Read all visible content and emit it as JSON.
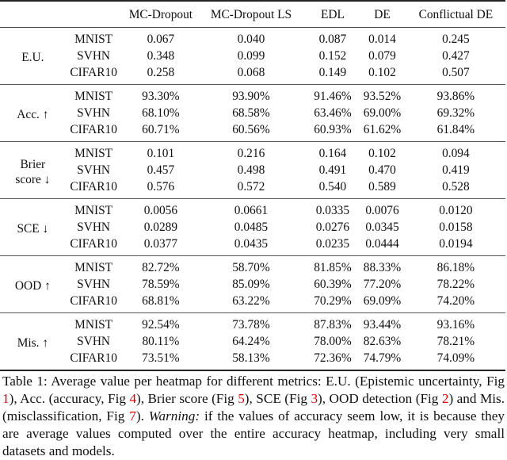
{
  "table": {
    "columns": [
      "",
      "",
      "MC-Dropout",
      "MC-Dropout LS",
      "EDL",
      "DE",
      "Conflictual DE"
    ],
    "groups": [
      {
        "metric": "E.U.",
        "rows": [
          {
            "dataset": "MNIST",
            "values": [
              "0.067",
              "0.040",
              "0.087",
              "0.014",
              "0.245"
            ],
            "bold": [
              false,
              false,
              false,
              false,
              false
            ]
          },
          {
            "dataset": "SVHN",
            "values": [
              "0.348",
              "0.099",
              "0.152",
              "0.079",
              "0.427"
            ],
            "bold": [
              false,
              false,
              false,
              false,
              false
            ]
          },
          {
            "dataset": "CIFAR10",
            "values": [
              "0.258",
              "0.068",
              "0.149",
              "0.102",
              "0.507"
            ],
            "bold": [
              false,
              false,
              false,
              false,
              false
            ]
          }
        ]
      },
      {
        "metric": "Acc. ↑",
        "rows": [
          {
            "dataset": "MNIST",
            "values": [
              "93.30%",
              "93.90%",
              "91.46%",
              "93.52%",
              "93.86%"
            ],
            "bold": [
              false,
              true,
              false,
              false,
              false
            ]
          },
          {
            "dataset": "SVHN",
            "values": [
              "68.10%",
              "68.58%",
              "63.46%",
              "69.00%",
              "69.32%"
            ],
            "bold": [
              false,
              false,
              false,
              false,
              true
            ]
          },
          {
            "dataset": "CIFAR10",
            "values": [
              "60.71%",
              "60.56%",
              "60.93%",
              "61.62%",
              "61.84%"
            ],
            "bold": [
              false,
              false,
              false,
              false,
              true
            ]
          }
        ]
      },
      {
        "metric": "Brier score ↓",
        "metric_line1": "Brier",
        "metric_line2": "score ↓",
        "rows": [
          {
            "dataset": "MNIST",
            "values": [
              "0.101",
              "0.216",
              "0.164",
              "0.102",
              "0.094"
            ],
            "bold": [
              false,
              false,
              false,
              false,
              true
            ]
          },
          {
            "dataset": "SVHN",
            "values": [
              "0.457",
              "0.498",
              "0.491",
              "0.470",
              "0.419"
            ],
            "bold": [
              false,
              false,
              false,
              false,
              true
            ]
          },
          {
            "dataset": "CIFAR10",
            "values": [
              "0.576",
              "0.572",
              "0.540",
              "0.589",
              "0.528"
            ],
            "bold": [
              false,
              false,
              false,
              false,
              true
            ]
          }
        ]
      },
      {
        "metric": "SCE ↓",
        "rows": [
          {
            "dataset": "MNIST",
            "values": [
              "0.0056",
              "0.0661",
              "0.0335",
              "0.0076",
              "0.0120"
            ],
            "bold": [
              true,
              false,
              false,
              false,
              false
            ]
          },
          {
            "dataset": "SVHN",
            "values": [
              "0.0289",
              "0.0485",
              "0.0276",
              "0.0345",
              "0.0158"
            ],
            "bold": [
              false,
              false,
              false,
              false,
              true
            ]
          },
          {
            "dataset": "CIFAR10",
            "values": [
              "0.0377",
              "0.0435",
              "0.0235",
              "0.0444",
              "0.0194"
            ],
            "bold": [
              false,
              false,
              false,
              false,
              true
            ]
          }
        ]
      },
      {
        "metric": "OOD ↑",
        "rows": [
          {
            "dataset": "MNIST",
            "values": [
              "82.72%",
              "58.70%",
              "81.85%",
              "88.33%",
              "86.18%"
            ],
            "bold": [
              false,
              false,
              false,
              true,
              false
            ]
          },
          {
            "dataset": "SVHN",
            "values": [
              "78.59%",
              "85.09%",
              "60.39%",
              "77.20%",
              "78.22%"
            ],
            "bold": [
              false,
              true,
              false,
              false,
              false
            ]
          },
          {
            "dataset": "CIFAR10",
            "values": [
              "68.81%",
              "63.22%",
              "70.29%",
              "69.09%",
              "74.20%"
            ],
            "bold": [
              false,
              false,
              false,
              false,
              true
            ]
          }
        ]
      },
      {
        "metric": "Mis. ↑",
        "rows": [
          {
            "dataset": "MNIST",
            "values": [
              "92.54%",
              "73.78%",
              "87.83%",
              "93.44%",
              "93.16%"
            ],
            "bold": [
              false,
              false,
              false,
              true,
              false
            ]
          },
          {
            "dataset": "SVHN",
            "values": [
              "80.11%",
              "64.24%",
              "78.00%",
              "82.63%",
              "78.21%"
            ],
            "bold": [
              false,
              false,
              false,
              true,
              false
            ]
          },
          {
            "dataset": "CIFAR10",
            "values": [
              "73.51%",
              "58.13%",
              "72.36%",
              "74.79%",
              "74.09%"
            ],
            "bold": [
              false,
              false,
              false,
              true,
              false
            ]
          }
        ]
      }
    ]
  },
  "caption": {
    "p1": "Table 1: Average value per heatmap for different metrics: E.U. (Epistemic uncertainty, Fig ",
    "ref1": "1",
    "p2": "), Acc. (accuracy, Fig ",
    "ref2": "4",
    "p3": "), Brier score (Fig ",
    "ref3": "5",
    "p4": "), SCE (Fig ",
    "ref4": "3",
    "p5": "), OOD detection (Fig ",
    "ref5": "2",
    "p6": ") and Mis. (misclassification, Fig ",
    "ref6": "7",
    "p7": "). ",
    "warning_label": "Warning:",
    "p8": " if the values of accuracy seem low, it is because they are average values computed over the entire accuracy heatmap, including very small datasets and models."
  },
  "colors": {
    "reference_link": "#e00000",
    "text": "#111111"
  }
}
